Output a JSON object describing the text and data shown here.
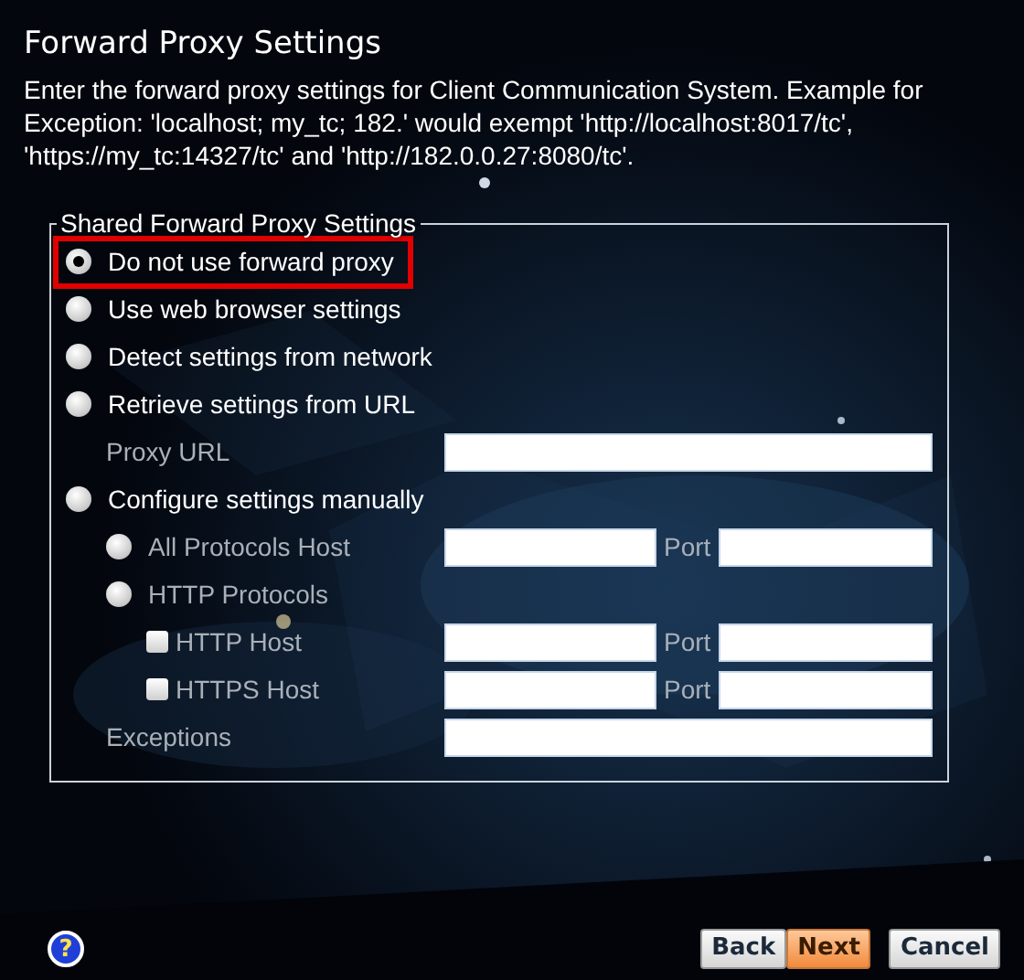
{
  "title": "Forward Proxy Settings",
  "description": "Enter the forward proxy settings for Client Communication System. Example for Exception: 'localhost; my_tc; 182.' would exempt 'http://localhost:8017/tc', 'https://my_tc:14327/tc' and 'http://182.0.0.27:8080/tc'.",
  "group": {
    "legend": "Shared Forward Proxy Settings",
    "options": [
      {
        "kind": "radio",
        "label": "Do not use forward proxy",
        "selected": true,
        "highlighted": true,
        "disabled": false
      },
      {
        "kind": "radio",
        "label": "Use web browser settings",
        "selected": false,
        "highlighted": false,
        "disabled": false
      },
      {
        "kind": "radio",
        "label": "Detect settings from network",
        "selected": false,
        "highlighted": false,
        "disabled": false
      },
      {
        "kind": "radio",
        "label": "Retrieve settings from URL",
        "selected": false,
        "highlighted": false,
        "disabled": false,
        "children": [
          {
            "kind": "field",
            "label": "Proxy URL",
            "disabled": true
          }
        ]
      },
      {
        "kind": "radio",
        "label": "Configure settings manually",
        "selected": false,
        "highlighted": false,
        "disabled": false,
        "children": [
          {
            "kind": "radio",
            "label": "All Protocols Host",
            "selected": false,
            "highlighted": false,
            "disabled": true,
            "port_label": "Port"
          },
          {
            "kind": "radio",
            "label": "HTTP Protocols",
            "selected": false,
            "highlighted": false,
            "disabled": true,
            "children": [
              {
                "kind": "checkbox",
                "label": "HTTP Host",
                "checked": false,
                "disabled": true,
                "port_label": "Port"
              },
              {
                "kind": "checkbox",
                "label": "HTTPS Host",
                "checked": false,
                "disabled": true,
                "port_label": "Port"
              }
            ]
          },
          {
            "kind": "field",
            "label": "Exceptions",
            "disabled": true
          }
        ]
      }
    ]
  },
  "help": "?",
  "buttons": [
    {
      "label": "Back",
      "default": false
    },
    {
      "label": "Next",
      "default": true
    },
    {
      "label": "Cancel",
      "default": false
    }
  ]
}
